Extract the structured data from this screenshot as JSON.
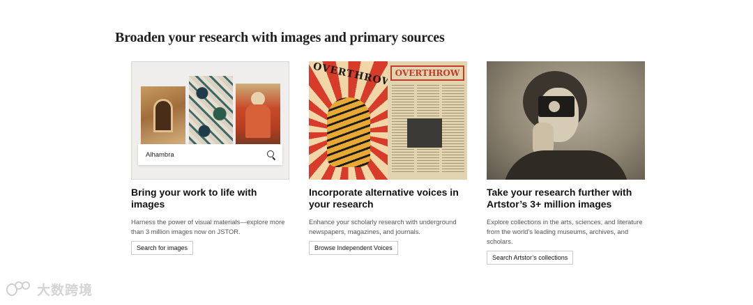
{
  "section": {
    "title": "Broaden your research with images and primary sources"
  },
  "cards": [
    {
      "thumbnail": {
        "search_value": "Alhambra",
        "icon": "search-icon"
      },
      "title": "Bring your work to life with images",
      "description": "Harness the power of visual materials—explore more than 3 million images now on JSTOR.",
      "button_label": "Search for images"
    },
    {
      "thumbnail": {
        "masthead_left": "OVERTHROW",
        "masthead_right": "OVERTHROW"
      },
      "title": "Incorporate alternative voices in your research",
      "description": "Enhance your scholarly research with underground newspapers, magazines, and journals.",
      "button_label": "Browse Independent Voices"
    },
    {
      "title": "Take your research further with Artstor’s 3+ million images",
      "description": "Explore collections in the arts, sciences, and literature from the world’s leading museums, archives, and scholars.",
      "button_label": "Search Artstor’s collections"
    }
  ],
  "watermark": {
    "text": "大数跨境"
  }
}
